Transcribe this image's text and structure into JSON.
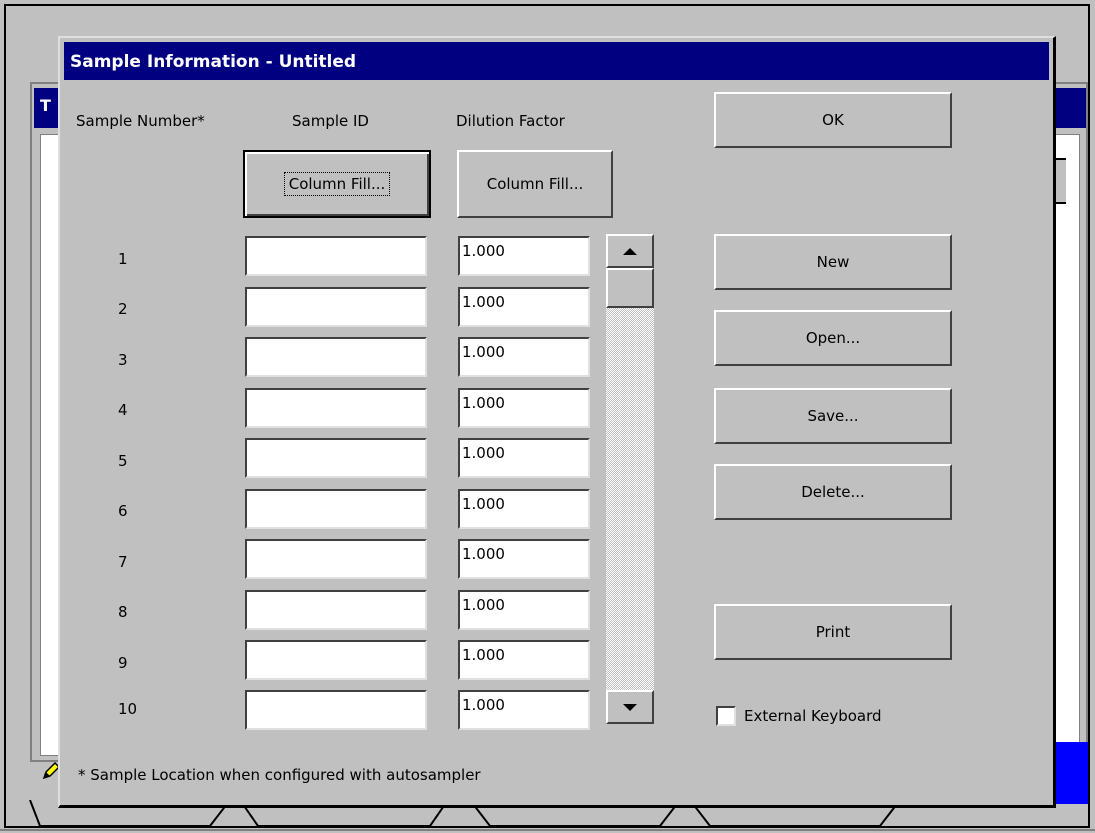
{
  "background_window": {
    "title_fragment": "T"
  },
  "dialog": {
    "title": "Sample Information - Untitled",
    "headers": {
      "sample_number": "Sample Number*",
      "sample_id": "Sample ID",
      "dilution_factor": "Dilution Factor"
    },
    "column_fill_id": "Column Fill...",
    "column_fill_df": "Column Fill...",
    "rows": [
      {
        "number": "1",
        "sample_id": "",
        "dilution": "1.000"
      },
      {
        "number": "2",
        "sample_id": "",
        "dilution": "1.000"
      },
      {
        "number": "3",
        "sample_id": "",
        "dilution": "1.000"
      },
      {
        "number": "4",
        "sample_id": "",
        "dilution": "1.000"
      },
      {
        "number": "5",
        "sample_id": "",
        "dilution": "1.000"
      },
      {
        "number": "6",
        "sample_id": "",
        "dilution": "1.000"
      },
      {
        "number": "7",
        "sample_id": "",
        "dilution": "1.000"
      },
      {
        "number": "8",
        "sample_id": "",
        "dilution": "1.000"
      },
      {
        "number": "9",
        "sample_id": "",
        "dilution": "1.000"
      },
      {
        "number": "10",
        "sample_id": "",
        "dilution": "1.000"
      }
    ],
    "buttons": {
      "ok": "OK",
      "new": "New",
      "open": "Open...",
      "save": "Save...",
      "delete": "Delete...",
      "print": "Print"
    },
    "external_keyboard": {
      "label": "External Keyboard",
      "checked": false
    },
    "footnote": "* Sample Location when configured with autosampler"
  },
  "colors": {
    "titlebar": "#000080",
    "face": "#c0c0c0",
    "accent_blue": "#0000ff"
  }
}
